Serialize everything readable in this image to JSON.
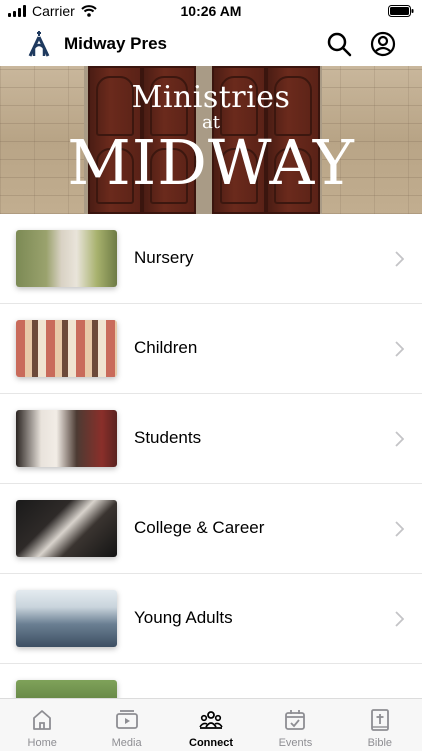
{
  "status_bar": {
    "carrier": "Carrier",
    "time": "10:26 AM"
  },
  "nav": {
    "title": "Midway Pres",
    "icons": [
      "search-icon",
      "profile-icon"
    ]
  },
  "banner": {
    "line1": "Ministries",
    "line2": "at",
    "line3": "MIDWAY"
  },
  "ministries": [
    {
      "label": "Nursery"
    },
    {
      "label": "Children"
    },
    {
      "label": "Students"
    },
    {
      "label": "College & Career"
    },
    {
      "label": "Young Adults"
    },
    {
      "label": ""
    }
  ],
  "tabs": [
    {
      "label": "Home",
      "icon": "home-icon"
    },
    {
      "label": "Media",
      "icon": "media-icon"
    },
    {
      "label": "Connect",
      "icon": "connect-icon",
      "active": true
    },
    {
      "label": "Events",
      "icon": "events-icon"
    },
    {
      "label": "Bible",
      "icon": "bible-icon"
    }
  ],
  "colors": {
    "accent": "#1f3a5f",
    "inactive_tab": "#8e8e93",
    "active_tab": "#000000"
  }
}
